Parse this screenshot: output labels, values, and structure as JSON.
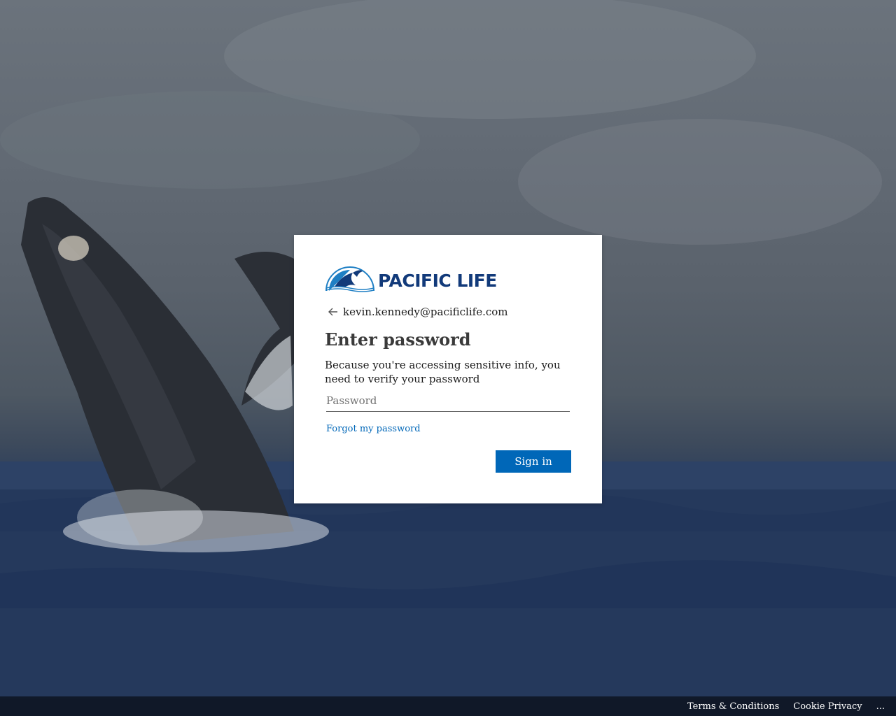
{
  "brand": {
    "name": "PACIFIC LIFE",
    "logo_icon": "whale-breach-logo-icon",
    "color": "#123a7a",
    "accent": "#1f7fc4"
  },
  "identity": {
    "back_icon": "arrow-left-icon",
    "email": "kevin.kennedy@pacificlife.com"
  },
  "main": {
    "title": "Enter password",
    "description": "Because you're accessing sensitive info, you need to verify your password",
    "password_placeholder": "Password",
    "forgot_label": "Forgot my password",
    "signin_label": "Sign in",
    "signin_color": "#0067b8"
  },
  "footer": {
    "items": [
      {
        "label": "Terms & Conditions"
      },
      {
        "label": "Cookie Privacy"
      },
      {
        "label": "..."
      }
    ]
  }
}
